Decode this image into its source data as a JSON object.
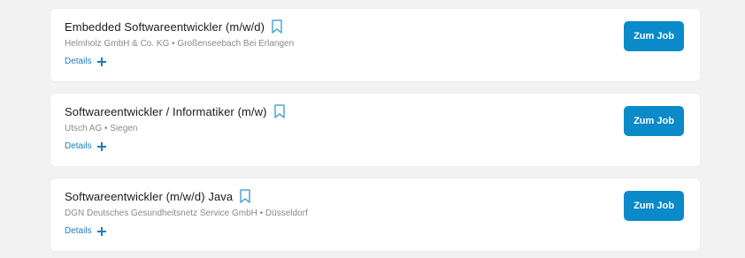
{
  "jobs": [
    {
      "title": "Embedded Softwareentwickler (m/w/d)",
      "company_line": "Helmholz GmbH & Co. KG • Großenseebach Bei Erlangen",
      "details_label": "Details",
      "button_label": "Zum Job"
    },
    {
      "title": "Softwareentwickler / Informatiker (m/w)",
      "company_line": "Utsch AG • Siegen",
      "details_label": "Details",
      "button_label": "Zum Job"
    },
    {
      "title": "Softwareentwickler (m/w/d) Java",
      "company_line": "DGN Deutsches Gesundheitsnetz Service GmbH • Düsseldorf",
      "details_label": "Details",
      "button_label": "Zum Job"
    }
  ],
  "icons": {
    "bookmark": "bookmark-icon",
    "expand": "plus-icon"
  },
  "colors": {
    "background": "#f2f2f2",
    "card": "#ffffff",
    "accent": "#0a8ac9",
    "link": "#1f7db8",
    "bookmark_outline": "#4fa7d9",
    "muted_text": "#8a8a8a"
  }
}
